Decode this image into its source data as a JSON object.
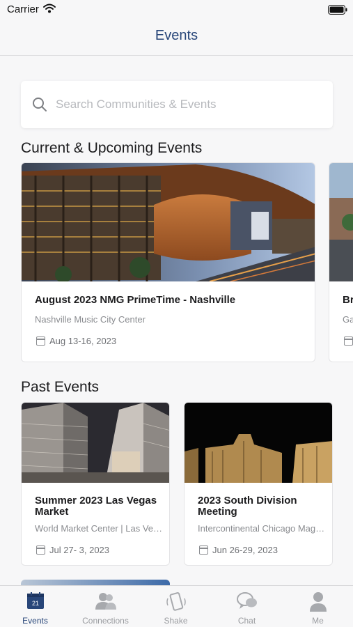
{
  "status_bar": {
    "carrier": "Carrier"
  },
  "nav": {
    "title": "Events"
  },
  "search": {
    "placeholder": "Search Communities & Events"
  },
  "sections": {
    "current": "Current & Upcoming Events",
    "past": "Past Events"
  },
  "current_events": [
    {
      "title": "August 2023 NMG PrimeTime - Nashville",
      "venue": "Nashville Music City Center",
      "date": "Aug 13-16, 2023"
    },
    {
      "title": "Br",
      "venue": "Ga",
      "date": ""
    }
  ],
  "past_events": [
    {
      "title": "Summer 2023 Las Vegas Market",
      "venue": "World Market Center | Las Vegas",
      "date": "Jul 27- 3, 2023"
    },
    {
      "title": "2023 South Division Meeting",
      "venue": "Intercontinental Chicago Magnificent Mile",
      "date": "Jun 26-29, 2023"
    }
  ],
  "tabs": [
    {
      "label": "Events",
      "icon": "calendar-icon",
      "badge": "21"
    },
    {
      "label": "Connections",
      "icon": "people-icon"
    },
    {
      "label": "Shake",
      "icon": "phone-shake-icon"
    },
    {
      "label": "Chat",
      "icon": "chat-bubbles-icon"
    },
    {
      "label": "Me",
      "icon": "person-icon"
    }
  ],
  "colors": {
    "accent": "#284679",
    "inactive": "#9a9ca0",
    "background": "#f7f7f8"
  }
}
